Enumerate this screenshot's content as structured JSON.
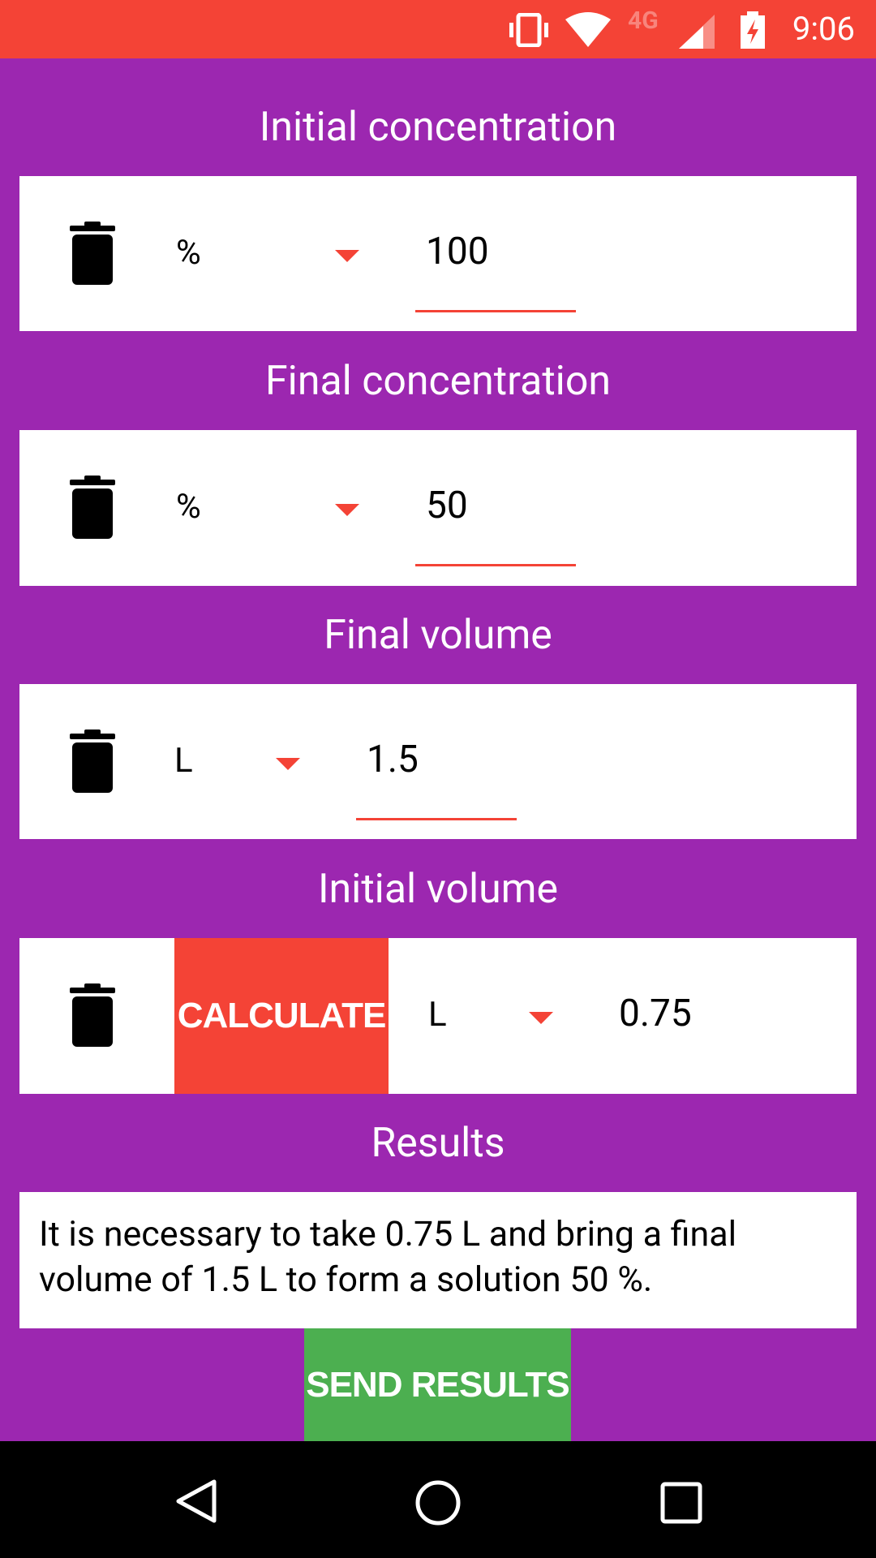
{
  "status_bar": {
    "time": "9:06",
    "network": "4G",
    "icons": [
      "vibrate-icon",
      "wifi-icon",
      "signal-icon",
      "battery-charging-icon"
    ]
  },
  "colors": {
    "primary": "#9C27B0",
    "accent": "#F44336",
    "send": "#4CAF50"
  },
  "sections": [
    {
      "title": "Initial concentration",
      "unit": "%",
      "value": "100"
    },
    {
      "title": "Final concentration",
      "unit": "%",
      "value": "50"
    },
    {
      "title": "Final volume",
      "unit": "L",
      "value": "1.5"
    },
    {
      "title": "Initial volume",
      "unit": "L",
      "value": "0.75",
      "button": "CALCULATE"
    }
  ],
  "results": {
    "title": "Results",
    "text": "It is necessary to take 0.75 L and bring a final volume of 1.5 L to form a solution 50 %."
  },
  "send_label": "SEND RESULTS"
}
